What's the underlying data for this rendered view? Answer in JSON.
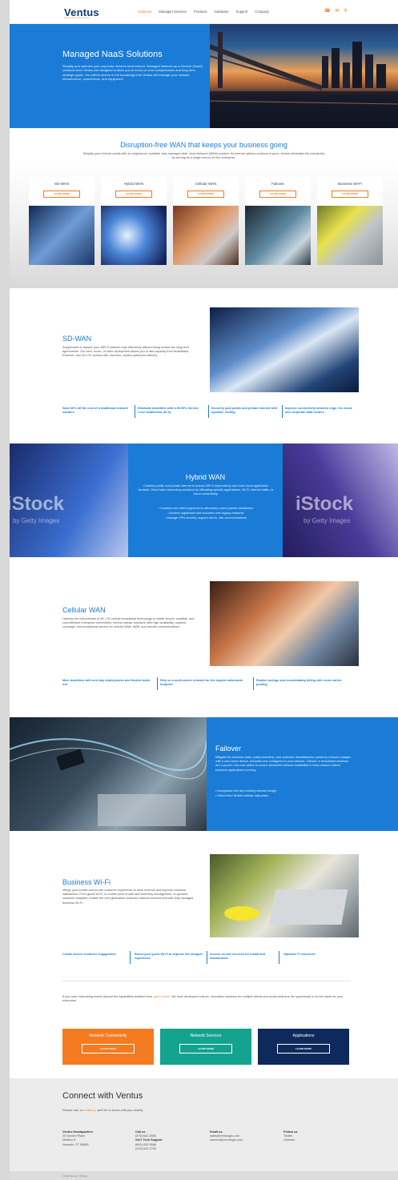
{
  "header": {
    "logo": "Ventus",
    "tagline": "Networked Services",
    "nav": [
      "Solutions",
      "Managed Services",
      "Products",
      "Hardware",
      "Support",
      "Company"
    ],
    "icons": [
      "phone-icon",
      "mail-icon",
      "search-icon"
    ]
  },
  "hero": {
    "title": "Managed NaaS Solutions",
    "text": "Simplify and optimize your corporate network environment. Managed Network-as-a-Service (NaaS) solutions from Ventus are designed to allow you to focus on core competencies and long-term strategic goals. You will be secure in the knowledge that Ventus will manage your network infrastructure, connections, and equipment."
  },
  "disruption": {
    "title": "Disruption-free WAN that keeps your business going",
    "subtitle": "Simplify your internet needs with an engineered, scalable, fully managed wide- Area Network (WAN) solution. As internet options continue to grow, Ventus eliminates the complexity by serving as a single source for the enterprise.",
    "cards": [
      {
        "title": "SD-WAN",
        "button": "LEARN MORE"
      },
      {
        "title": "Hybrid WAN",
        "button": "LEARN MORE"
      },
      {
        "title": "Cellular WAN",
        "button": "LEARN MORE"
      },
      {
        "title": "Failover",
        "button": "LEARN MORE"
      },
      {
        "title": "Business Wi-Fi",
        "button": "LEARN MORE"
      }
    ]
  },
  "sdwan": {
    "title": "SD-WAN",
    "text": "Supplement or replace your MPLS network cost-effectively without being locked into long-term agreements. Our zero- touch, on-time deployment allows you to add capacity from broadband, Ethernet, and 4G LTE service with real-time, packet-optimized delivery.",
    "features": [
      "Save 60% off the cost of a traditional network solution",
      "Eliminate downtime with a 99.99% Service Level Attainment (SLA)",
      "Securely pool public and private internet with dynamic routing",
      "Improve connectivity between edge, the cloud, and corporate data centers"
    ]
  },
  "hybrid": {
    "title": "Hybrid WAN",
    "text": "Combine public and private internet to reduce MPLS dependency and meet cloud application demand. Drive basic networking solutions by offloading specific applications, Wi-Fi, internet traffic, or cloud connectivity.",
    "bullets": [
      "• Combine two WAN segments to alternately control packet distribution",
      "• Achieve significant cost reduction over legacy networks",
      "• Manage VPN security, support site-to- site communications"
    ],
    "watermark": "iStock",
    "watermark_sub": "by Getty Images"
  },
  "cellular": {
    "title": "Cellular WAN",
    "text": "Harness the full potential of 4G LTE cellular broadband technology to create secure, scalable, and cost-effective enterprise connectivity. Ventus cellular solutions offer high availability, superior coverage, and exceptional service for cellular WAN, M2M, and remote communications.",
    "features": [
      "Meet deadlines with next day deployments and flexible build out",
      "Rely on a multi-carrier network for the largest nationwide footprint",
      "Realize savings and consolidating billing with cross carrier pooling"
    ]
  },
  "failover": {
    "title": "Failover",
    "text": "Mitigate the business risks, costly downtime, and customer dissatisfaction posed by network outages with a zero-touch device, activated and configured to your network. Cellular or broadband solutions are a proven, low-cost option to ensure persistent network availability to keep mission-critical business applications running.",
    "bullets": [
      "• Incorporate into any existing network design",
      "• Select from flexible cellular data plans"
    ]
  },
  "wifi": {
    "title": "Business Wi-Fi",
    "text": "Merge your mobile and on-site customer experience to drive revenue and improve customer satisfaction. From guest Wi-Fi, to mobile point of sale and inventory management, to dynamic customer analytics, enable the next generation business network environment with fully managed business Wi-Fi.",
    "features": [
      "Create secure customer engagement",
      "Brand your guest Wi-Fi to improve the shopper experience",
      "Access on-site services for install and maintenance",
      "Optimize IT resources"
    ]
  },
  "beyond": {
    "text_before": "If you have networking needs beyond the capabilities detailed here,",
    "link": "get in touch",
    "text_after": ". We have developed custom, innovative solutions for multiple clients and would welcome the opportunity to do the same for your enterprise."
  },
  "boxes": [
    {
      "title": "Network Connectivity",
      "button": "LEARN MORE",
      "color": "#f47b20"
    },
    {
      "title": "Network Services",
      "button": "LEARN MORE",
      "color": "#13a38f"
    },
    {
      "title": "Applications",
      "button": "LEARN MORE",
      "color": "#0e2a5c"
    }
  ],
  "connect": {
    "title": "Connect with Ventus",
    "sub_before": "Please call, or",
    "sub_link": "email us",
    "sub_after": ", we'll be in touch with you shortly.",
    "hq_title": "Ventus Headquarters",
    "hq_lines": [
      "20 Norden Place",
      "Mailbox 8",
      "Norwalk, CT 06855"
    ],
    "call_title": "Call us",
    "call_line": "(203) 642-2800",
    "support_title": "24x7 Tech Support",
    "support_lines": [
      "(800) 620-3586",
      "(203) 642-2799"
    ],
    "email_title": "Email us",
    "email_lines": [
      "sales@ventusglo.com",
      "careers@ventusglo.com"
    ],
    "follow_title": "Follow us",
    "follow_lines": [
      "Twitter",
      "LinkedIn"
    ],
    "copyright": "©2022 Ventus · Privacy ·"
  },
  "colors": {
    "brand_blue": "#1a7cd6",
    "accent_orange": "#f47b20",
    "navy": "#0b3a7a"
  }
}
